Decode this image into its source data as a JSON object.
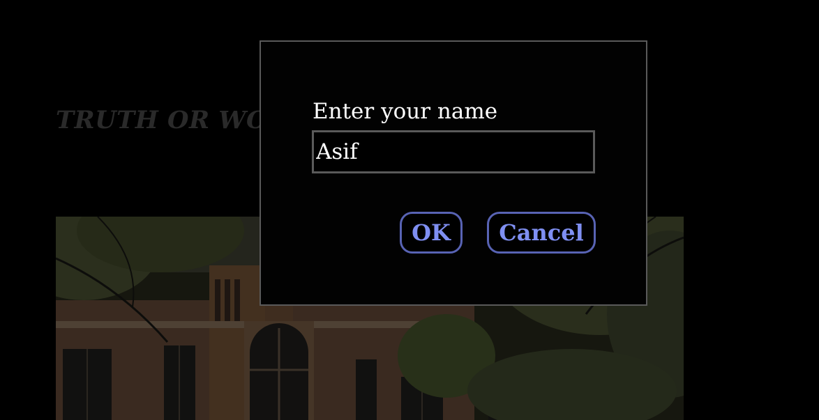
{
  "page": {
    "title": "TRUTH OR WOULD YOU RATHER"
  },
  "dialog": {
    "label": "Enter your name",
    "input_value": "Asif",
    "ok_label": "OK",
    "cancel_label": "Cancel"
  },
  "colors": {
    "background": "#000000",
    "dialog_border": "#5a5a5a",
    "button_border": "#5863b4",
    "button_text": "#7f8ff2",
    "label_text": "#ffffff",
    "dimmed_title": "#2a2a2a"
  }
}
